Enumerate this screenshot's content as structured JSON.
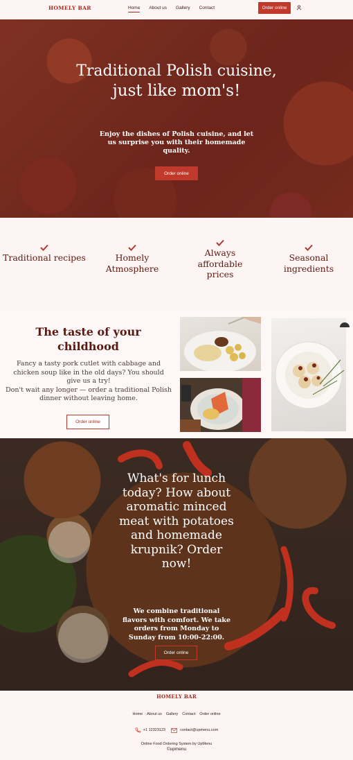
{
  "header": {
    "logo": "HOMELY BAR",
    "nav": [
      "Home",
      "About us",
      "Gallery",
      "Contact"
    ],
    "active_nav": "Home",
    "order_button": "Order online",
    "user_icon": "user-icon"
  },
  "hero": {
    "title_line1": "Traditional Polish cuisine,",
    "title_line2": "just like mom's!",
    "subtitle": "Enjoy the dishes of Polish cuisine, and let us surprise you with their homemade quality.",
    "button": "Order online"
  },
  "features": [
    {
      "icon": "check-icon",
      "text": "Traditional recipes"
    },
    {
      "icon": "check-icon",
      "text": "Homely Atmosphere"
    },
    {
      "icon": "check-icon",
      "text": "Always affordable prices"
    },
    {
      "icon": "check-icon",
      "text": "Seasonal ingredients"
    }
  ],
  "taste": {
    "title": "The taste of your childhood",
    "text1": "Fancy a tasty pork cutlet with cabbage and chicken soup like in the old days? You should give us a try!",
    "text2": "Don't wait any longer — order a traditional Polish dinner without leaving home.",
    "button": "Order online"
  },
  "lunch": {
    "title": "What's for lunch today? How about aromatic minced meat with potatoes and homemade krupnik? Order now!",
    "subtitle": "We combine traditional flavors with comfort. We take orders from Monday to Sunday from 10:00-22:00.",
    "button": "Order online"
  },
  "footer": {
    "logo": "HOMELY BAR",
    "nav": [
      "Home",
      "About us",
      "Gallery",
      "Contact",
      "Order online"
    ],
    "phone": "+1 12323123",
    "email": "contact@upmenu.com",
    "powered": "Online Food Ordering System by UpMenu",
    "brand": "upmenu"
  },
  "colors": {
    "accent": "#c0392b",
    "brand_text": "#a52a1e",
    "heading": "#5a1a12",
    "background": "#fdf5f3"
  }
}
